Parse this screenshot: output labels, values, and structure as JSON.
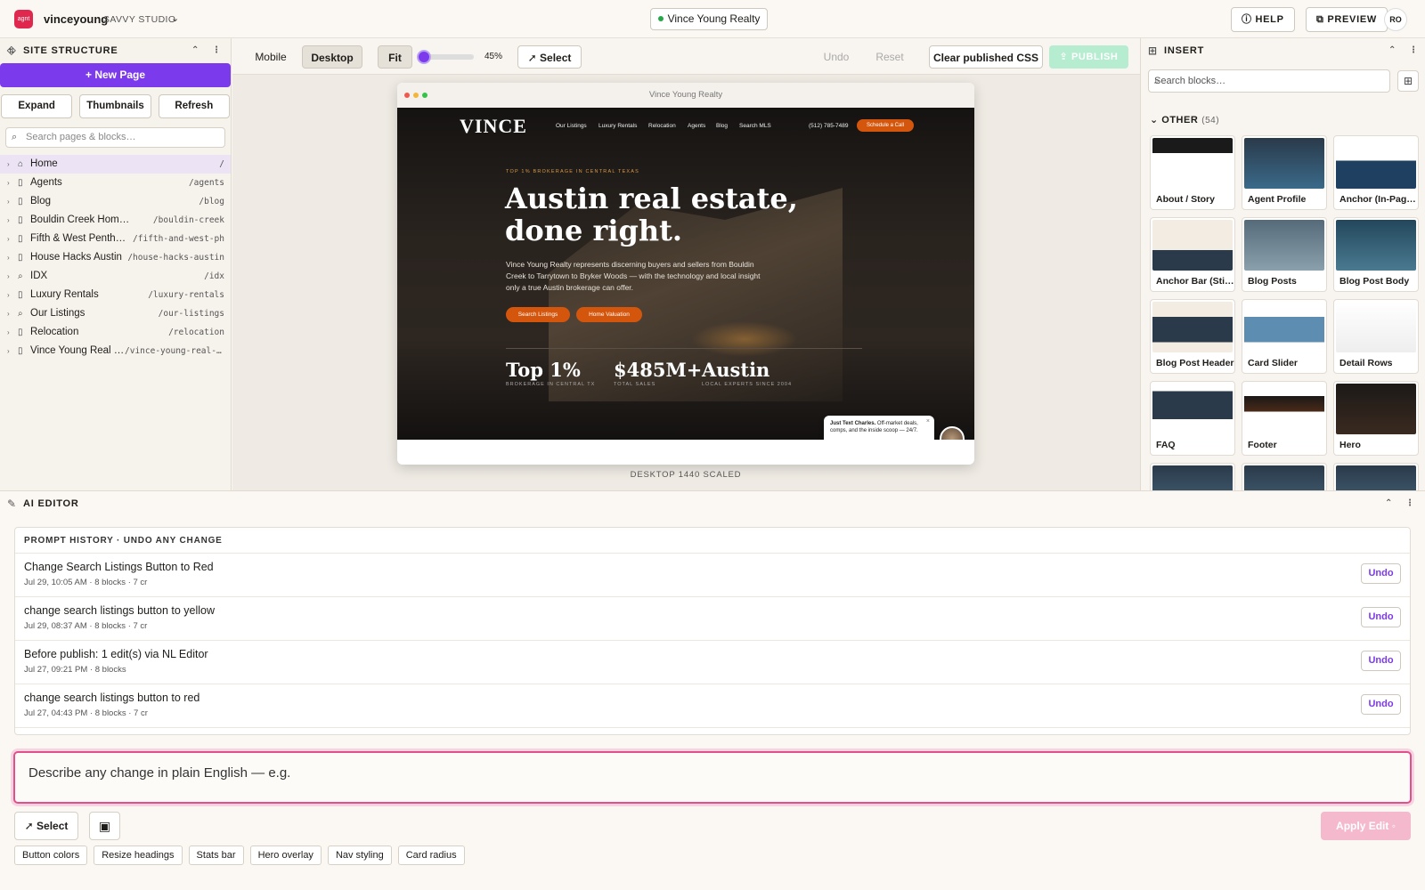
{
  "topbar": {
    "logo_text": "agnt",
    "brand": "vinceyoung",
    "studio": "SAVVY STUDIO",
    "site": "Vince Young Realty",
    "help": "HELP",
    "preview": "PREVIEW",
    "avatar": "RO",
    "help_icon": "question-circle-icon",
    "preview_icon": "external-link-icon"
  },
  "site_structure": {
    "title": "SITE STRUCTURE",
    "new_page": "+ New Page",
    "buttons": [
      "Expand",
      "Thumbnails",
      "Refresh"
    ],
    "search_placeholder": "Search pages & blocks…",
    "pages": [
      {
        "name": "Home",
        "slug": "/",
        "icon": "home-icon",
        "active": true
      },
      {
        "name": "Agents",
        "slug": "/agents",
        "icon": "page-icon"
      },
      {
        "name": "Blog",
        "slug": "/blog",
        "icon": "page-icon"
      },
      {
        "name": "Bouldin Creek Homes for Sale",
        "slug": "/bouldin-creek",
        "icon": "page-icon"
      },
      {
        "name": "Fifth & West Penthouse",
        "slug": "/fifth-and-west-ph",
        "icon": "page-icon"
      },
      {
        "name": "House Hacks Austin",
        "slug": "/house-hacks-austin",
        "icon": "page-icon"
      },
      {
        "name": "IDX",
        "slug": "/idx",
        "icon": "search-icon"
      },
      {
        "name": "Luxury Rentals",
        "slug": "/luxury-rentals",
        "icon": "page-icon"
      },
      {
        "name": "Our Listings",
        "slug": "/our-listings",
        "icon": "search-icon"
      },
      {
        "name": "Relocation",
        "slug": "/relocation",
        "icon": "page-icon"
      },
      {
        "name": "Vince Young Real Es…",
        "slug": "/vince-young-real-e…",
        "icon": "page-icon"
      }
    ]
  },
  "canvas_toolbar": {
    "mobile": "Mobile",
    "desktop": "Desktop",
    "fit": "Fit",
    "zoom": "45%",
    "zoom_fraction": 0.45,
    "select": "Select",
    "undo": "Undo",
    "reset": "Reset",
    "clear_css": "Clear published CSS",
    "publish": "PUBLISH"
  },
  "preview": {
    "window_title": "Vince Young Realty",
    "logo": "VINCE",
    "nav": [
      "Our Listings",
      "Luxury Rentals",
      "Relocation",
      "Agents",
      "Blog",
      "Search MLS"
    ],
    "phone": "(512) 785-7489",
    "cta": "Schedule a Call",
    "kicker": "TOP 1% BROKERAGE IN CENTRAL TEXAS",
    "headline": "Austin real estate, done right.",
    "subtext": "Vince Young Realty represents discerning buyers and sellers from Bouldin Creek to Tarrytown to Bryker Woods — with the technology and local insight only a true Austin brokerage can offer.",
    "btn1": "Search Listings",
    "btn2": "Home Valuation",
    "stats": [
      {
        "value": "Top 1%",
        "label": "BROKERAGE IN CENTRAL TX"
      },
      {
        "value": "$485M+",
        "label": "TOTAL SALES"
      },
      {
        "value": "Austin",
        "label": "LOCAL EXPERTS SINCE 2004"
      }
    ],
    "chat_bold": "Just Text Charles.",
    "chat_text": "Off-market deals, comps, and the inside scoop — 24/7.",
    "caption": "DESKTOP 1440 SCALED"
  },
  "insert": {
    "title": "INSERT",
    "search_placeholder": "Search blocks…",
    "category": "OTHER",
    "count": "(54)",
    "blocks": [
      "About / Story",
      "Agent Profile",
      "Anchor (In-Pag…",
      "Anchor Bar (Sti…",
      "Blog Posts",
      "Blog Post Body",
      "Blog Post Header",
      "Card Slider",
      "Detail Rows",
      "FAQ",
      "Footer",
      "Hero"
    ]
  },
  "ai_editor": {
    "title": "AI EDITOR",
    "history_title": "PROMPT HISTORY · UNDO ANY CHANGE",
    "undo": "Undo",
    "history": [
      {
        "title": "Change Search Listings Button to Red",
        "meta": "Jul 29, 10:05 AM · 8 blocks · 7 cr"
      },
      {
        "title": "change search listings button to yellow",
        "meta": "Jul 29, 08:37 AM · 8 blocks · 7 cr"
      },
      {
        "title": "Before publish: 1 edit(s) via NL Editor",
        "meta": "Jul 27, 09:21 PM · 8 blocks"
      },
      {
        "title": "change search listings button to red",
        "meta": "Jul 27, 04:43 PM · 8 blocks · 7 cr"
      }
    ],
    "prompt_placeholder": "Describe any change in plain English — e.g.",
    "select": "Select",
    "apply": "Apply Edit",
    "chips": [
      "Button colors",
      "Resize headings",
      "Stats bar",
      "Hero overlay",
      "Nav styling",
      "Card radius"
    ]
  },
  "colors": {
    "accent": "#7c3aed",
    "cta_orange": "#d4560d",
    "prompt_border": "#e0508a",
    "online": "#26a84a"
  }
}
